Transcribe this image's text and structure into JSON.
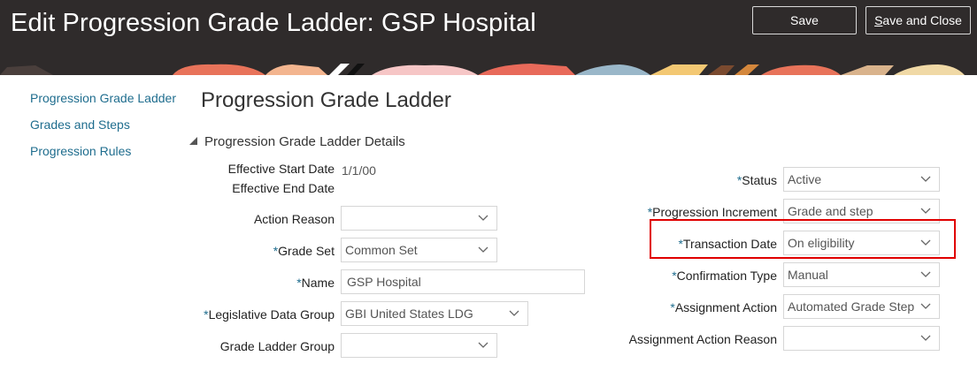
{
  "header": {
    "title": "Edit Progression Grade Ladder: GSP Hospital",
    "save_label": "Save",
    "save_close_first": "S",
    "save_close_rest": "ave and Close"
  },
  "nav": {
    "items": [
      {
        "label": "Progression Grade Ladder"
      },
      {
        "label": "Grades and Steps"
      },
      {
        "label": "Progression Rules"
      }
    ]
  },
  "main": {
    "title": "Progression Grade Ladder",
    "section_title": "Progression Grade Ladder Details"
  },
  "left_form": {
    "effective_start_label": "Effective Start Date",
    "effective_start_value": "1/1/00",
    "effective_end_label": "Effective End Date",
    "action_reason_label": "Action Reason",
    "action_reason_value": "",
    "grade_set_label": "Grade Set",
    "grade_set_value": "Common Set",
    "name_label": "Name",
    "name_value": "GSP Hospital",
    "ldg_label": "Legislative Data Group",
    "ldg_value": "GBI United States LDG",
    "ladder_group_label": "Grade Ladder Group",
    "ladder_group_value": ""
  },
  "right_form": {
    "status_label": "Status",
    "status_value": "Active",
    "increment_label": "Progression Increment",
    "increment_value": "Grade and step",
    "transaction_date_label": "Transaction Date",
    "transaction_date_value": "On eligibility",
    "confirmation_label": "Confirmation Type",
    "confirmation_value": "Manual",
    "assignment_action_label": "Assignment Action",
    "assignment_action_value": "Automated Grade Step",
    "assignment_reason_label": "Assignment Action Reason",
    "assignment_reason_value": ""
  },
  "required_marker": "*",
  "colors": {
    "header_bg": "#2f2b2b",
    "link": "#1f6d8e",
    "highlight": "#e00000"
  }
}
